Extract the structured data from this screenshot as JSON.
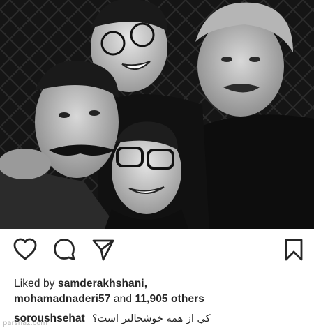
{
  "post": {
    "photo_alt": "Black and white group selfie of four smiling men",
    "likes_prefix": "Liked by",
    "liker_1": "samderakhshani,",
    "liker_2": "mohamadnaderi57",
    "likes_and": "and",
    "likes_count": "11,905 others",
    "caption_user": "soroushsehat",
    "caption_text": "کي از همه خوشحالتر است؟"
  },
  "icons": {
    "like": "heart-icon",
    "comment": "comment-bubble-icon",
    "share": "paper-plane-icon",
    "save": "bookmark-icon"
  },
  "watermark": "parsnaz.com",
  "colors": {
    "text": "#262626",
    "background": "#ffffff"
  }
}
